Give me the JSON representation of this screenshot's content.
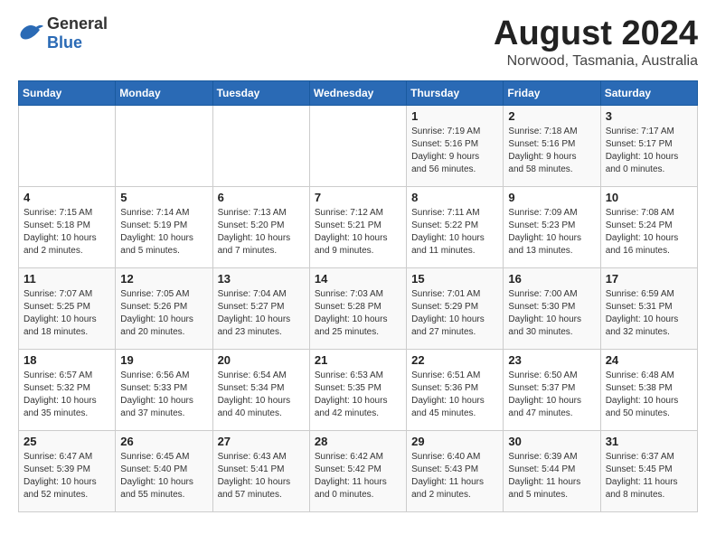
{
  "header": {
    "logo": {
      "general": "General",
      "blue": "Blue"
    },
    "title": "August 2024",
    "subtitle": "Norwood, Tasmania, Australia"
  },
  "days_of_week": [
    "Sunday",
    "Monday",
    "Tuesday",
    "Wednesday",
    "Thursday",
    "Friday",
    "Saturday"
  ],
  "weeks": [
    [
      {
        "day": "",
        "info": ""
      },
      {
        "day": "",
        "info": ""
      },
      {
        "day": "",
        "info": ""
      },
      {
        "day": "",
        "info": ""
      },
      {
        "day": "1",
        "info": "Sunrise: 7:19 AM\nSunset: 5:16 PM\nDaylight: 9 hours\nand 56 minutes."
      },
      {
        "day": "2",
        "info": "Sunrise: 7:18 AM\nSunset: 5:16 PM\nDaylight: 9 hours\nand 58 minutes."
      },
      {
        "day": "3",
        "info": "Sunrise: 7:17 AM\nSunset: 5:17 PM\nDaylight: 10 hours\nand 0 minutes."
      }
    ],
    [
      {
        "day": "4",
        "info": "Sunrise: 7:15 AM\nSunset: 5:18 PM\nDaylight: 10 hours\nand 2 minutes."
      },
      {
        "day": "5",
        "info": "Sunrise: 7:14 AM\nSunset: 5:19 PM\nDaylight: 10 hours\nand 5 minutes."
      },
      {
        "day": "6",
        "info": "Sunrise: 7:13 AM\nSunset: 5:20 PM\nDaylight: 10 hours\nand 7 minutes."
      },
      {
        "day": "7",
        "info": "Sunrise: 7:12 AM\nSunset: 5:21 PM\nDaylight: 10 hours\nand 9 minutes."
      },
      {
        "day": "8",
        "info": "Sunrise: 7:11 AM\nSunset: 5:22 PM\nDaylight: 10 hours\nand 11 minutes."
      },
      {
        "day": "9",
        "info": "Sunrise: 7:09 AM\nSunset: 5:23 PM\nDaylight: 10 hours\nand 13 minutes."
      },
      {
        "day": "10",
        "info": "Sunrise: 7:08 AM\nSunset: 5:24 PM\nDaylight: 10 hours\nand 16 minutes."
      }
    ],
    [
      {
        "day": "11",
        "info": "Sunrise: 7:07 AM\nSunset: 5:25 PM\nDaylight: 10 hours\nand 18 minutes."
      },
      {
        "day": "12",
        "info": "Sunrise: 7:05 AM\nSunset: 5:26 PM\nDaylight: 10 hours\nand 20 minutes."
      },
      {
        "day": "13",
        "info": "Sunrise: 7:04 AM\nSunset: 5:27 PM\nDaylight: 10 hours\nand 23 minutes."
      },
      {
        "day": "14",
        "info": "Sunrise: 7:03 AM\nSunset: 5:28 PM\nDaylight: 10 hours\nand 25 minutes."
      },
      {
        "day": "15",
        "info": "Sunrise: 7:01 AM\nSunset: 5:29 PM\nDaylight: 10 hours\nand 27 minutes."
      },
      {
        "day": "16",
        "info": "Sunrise: 7:00 AM\nSunset: 5:30 PM\nDaylight: 10 hours\nand 30 minutes."
      },
      {
        "day": "17",
        "info": "Sunrise: 6:59 AM\nSunset: 5:31 PM\nDaylight: 10 hours\nand 32 minutes."
      }
    ],
    [
      {
        "day": "18",
        "info": "Sunrise: 6:57 AM\nSunset: 5:32 PM\nDaylight: 10 hours\nand 35 minutes."
      },
      {
        "day": "19",
        "info": "Sunrise: 6:56 AM\nSunset: 5:33 PM\nDaylight: 10 hours\nand 37 minutes."
      },
      {
        "day": "20",
        "info": "Sunrise: 6:54 AM\nSunset: 5:34 PM\nDaylight: 10 hours\nand 40 minutes."
      },
      {
        "day": "21",
        "info": "Sunrise: 6:53 AM\nSunset: 5:35 PM\nDaylight: 10 hours\nand 42 minutes."
      },
      {
        "day": "22",
        "info": "Sunrise: 6:51 AM\nSunset: 5:36 PM\nDaylight: 10 hours\nand 45 minutes."
      },
      {
        "day": "23",
        "info": "Sunrise: 6:50 AM\nSunset: 5:37 PM\nDaylight: 10 hours\nand 47 minutes."
      },
      {
        "day": "24",
        "info": "Sunrise: 6:48 AM\nSunset: 5:38 PM\nDaylight: 10 hours\nand 50 minutes."
      }
    ],
    [
      {
        "day": "25",
        "info": "Sunrise: 6:47 AM\nSunset: 5:39 PM\nDaylight: 10 hours\nand 52 minutes."
      },
      {
        "day": "26",
        "info": "Sunrise: 6:45 AM\nSunset: 5:40 PM\nDaylight: 10 hours\nand 55 minutes."
      },
      {
        "day": "27",
        "info": "Sunrise: 6:43 AM\nSunset: 5:41 PM\nDaylight: 10 hours\nand 57 minutes."
      },
      {
        "day": "28",
        "info": "Sunrise: 6:42 AM\nSunset: 5:42 PM\nDaylight: 11 hours\nand 0 minutes."
      },
      {
        "day": "29",
        "info": "Sunrise: 6:40 AM\nSunset: 5:43 PM\nDaylight: 11 hours\nand 2 minutes."
      },
      {
        "day": "30",
        "info": "Sunrise: 6:39 AM\nSunset: 5:44 PM\nDaylight: 11 hours\nand 5 minutes."
      },
      {
        "day": "31",
        "info": "Sunrise: 6:37 AM\nSunset: 5:45 PM\nDaylight: 11 hours\nand 8 minutes."
      }
    ]
  ]
}
